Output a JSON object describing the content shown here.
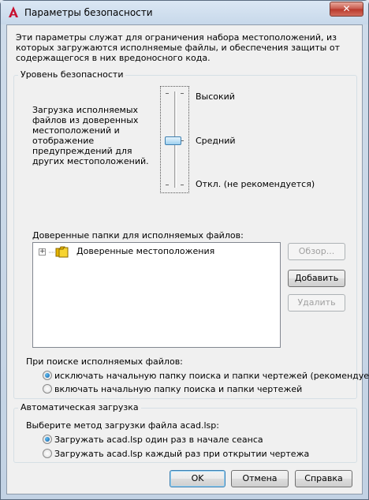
{
  "window": {
    "title": "Параметры безопасности",
    "close_symbol": "✕"
  },
  "intro": "Эти параметры служат для ограничения набора местоположений, из которых загружаются исполняемые файлы, и обеспечения защиты от содержащегося в них вредоносного кода.",
  "security": {
    "legend": "Уровень безопасности",
    "description": "Загрузка исполняемых файлов из доверенных местоположений и отображение предупреждений для других местоположений.",
    "levels": [
      "Высокий",
      "Средний",
      "Откл. (не рекомендуется)"
    ],
    "selected_level": "Средний"
  },
  "trusted": {
    "label": "Доверенные папки для исполняемых файлов:",
    "tree_root": "Доверенные местоположения",
    "buttons": {
      "browse": "Обзор...",
      "add": "Добавить",
      "delete": "Удалить"
    }
  },
  "search": {
    "label": "При поиске исполняемых файлов:",
    "options": [
      "исключать начальную папку поиска и папки чертежей (рекомендуется)",
      "включать начальную папку поиска и папки чертежей"
    ],
    "selected_index": 0
  },
  "autoload": {
    "legend": "Автоматическая загрузка",
    "label": "Выберите метод загрузки файла acad.lsp:",
    "options": [
      "Загружать acad.lsp один раз в начале сеанса",
      "Загружать acad.lsp каждый раз при открытии чертежа"
    ],
    "selected_index": 0
  },
  "footer": {
    "ok": "OK",
    "cancel": "Отмена",
    "help": "Справка"
  },
  "icons": {
    "app": "autocad-logo-icon",
    "folder": "folder-icon",
    "expander": "plus-expand-icon"
  },
  "colors": {
    "accent": "#3c7fb1",
    "close": "#c7574a"
  }
}
